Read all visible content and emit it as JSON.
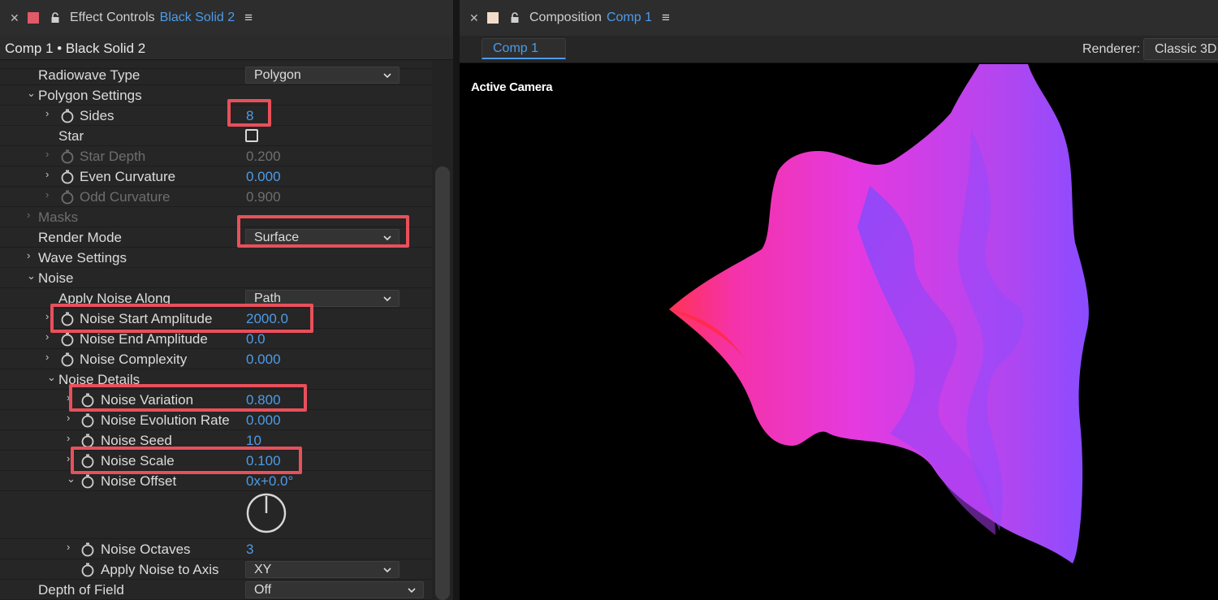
{
  "effect_controls": {
    "header": {
      "title": "Effect Controls",
      "layer_name": "Black Solid 2",
      "swatch_color": "#e05a68"
    },
    "layer_path": "Comp 1 • Black Solid 2",
    "properties": [
      {
        "label": "Radiowave Type",
        "dropdown": "Polygon"
      },
      {
        "label": "Polygon Settings"
      },
      {
        "label": "Sides",
        "value": "8"
      },
      {
        "label": "Star"
      },
      {
        "label": "Star Depth",
        "value": "0.200"
      },
      {
        "label": "Even Curvature",
        "value": "0.000"
      },
      {
        "label": "Odd Curvature",
        "value": "0.900"
      },
      {
        "label": "Masks"
      },
      {
        "label": "Render Mode",
        "dropdown": "Surface"
      },
      {
        "label": "Wave Settings"
      },
      {
        "label": "Noise"
      },
      {
        "label": "Apply Noise Along",
        "dropdown": "Path"
      },
      {
        "label": "Noise Start Amplitude",
        "value": "2000.0"
      },
      {
        "label": "Noise End Amplitude",
        "value": "0.0"
      },
      {
        "label": "Noise Complexity",
        "value": "0.000"
      },
      {
        "label": "Noise Details"
      },
      {
        "label": "Noise Variation",
        "value": "0.800"
      },
      {
        "label": "Noise Evolution Rate",
        "value": "0.000"
      },
      {
        "label": "Noise Seed",
        "value": "10"
      },
      {
        "label": "Noise Scale",
        "value": "0.100"
      },
      {
        "label": "Noise Offset",
        "value": "0x+0.0°"
      },
      {
        "label": "Noise Octaves",
        "value": "3"
      },
      {
        "label": "Apply Noise to Axis",
        "dropdown": "XY"
      },
      {
        "label": "Depth of Field",
        "dropdown": "Off"
      }
    ],
    "star_checked": false
  },
  "composition": {
    "header": {
      "title": "Composition",
      "comp_name": "Comp 1",
      "swatch_color": "#f2dcc8"
    },
    "tab_label": "Comp 1",
    "renderer_label": "Renderer:",
    "renderer_value": "Classic 3D",
    "camera_label": "Active Camera"
  },
  "colors": {
    "accent": "#4d9be8",
    "highlight": "#e8505b",
    "shape_hot": "#ff3355",
    "shape_mid": "#e43ae0",
    "shape_cool": "#8a4cff"
  },
  "icons": [
    "close-icon",
    "lock-icon",
    "panel-menu-icon",
    "twirl-icon",
    "stopwatch-icon",
    "chevron-down-icon",
    "angle-dial-icon"
  ]
}
